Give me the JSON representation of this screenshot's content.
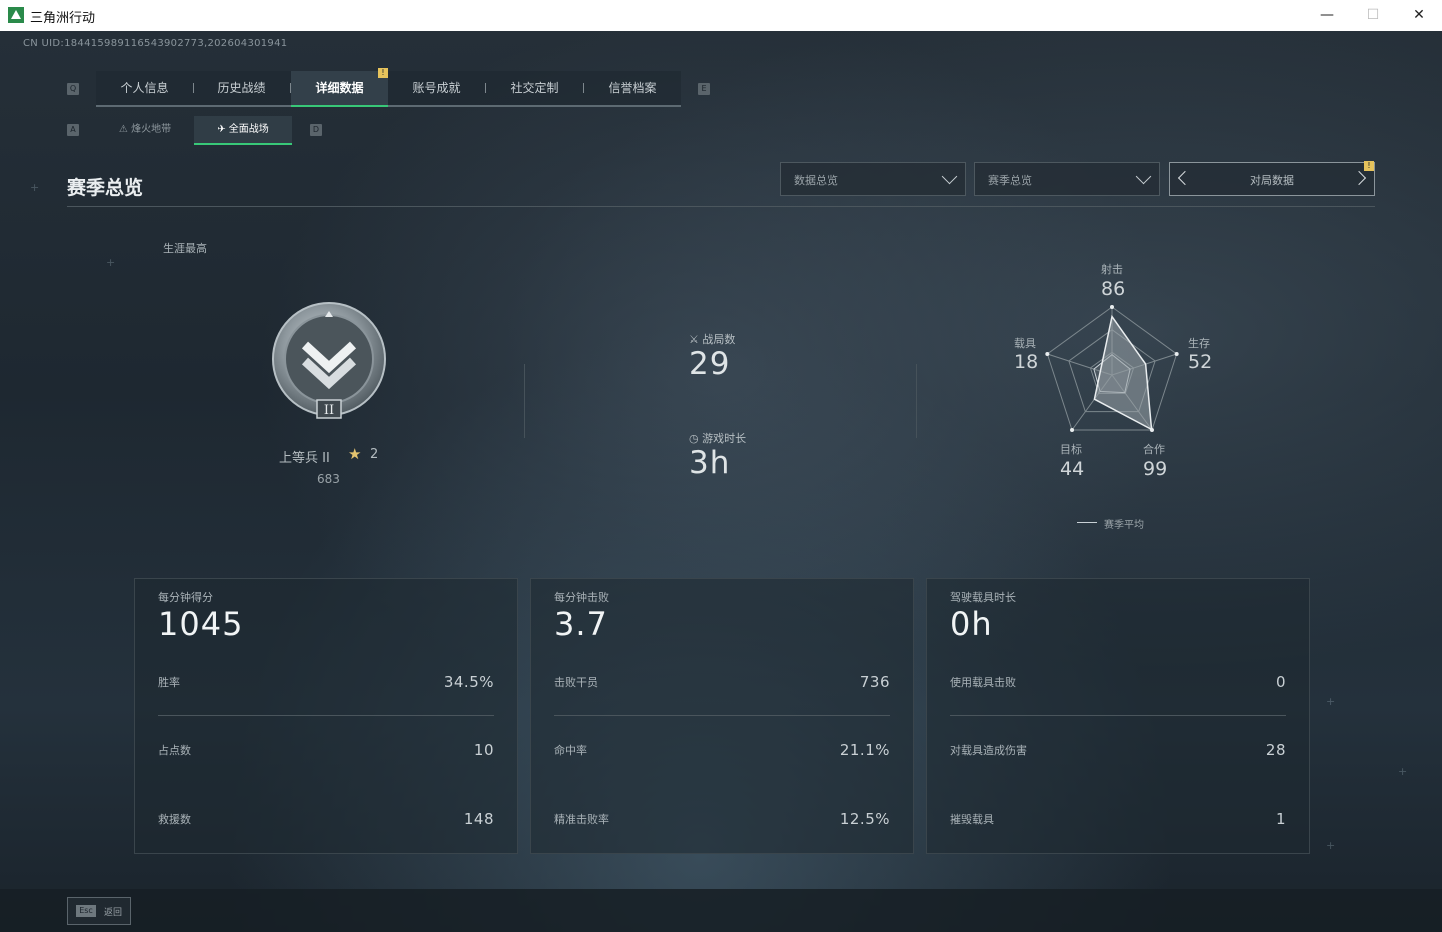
{
  "window": {
    "title": "三角洲行动",
    "minimize": "—",
    "maximize": "☐",
    "close": "✕"
  },
  "uid": "CN UID:184415989116543902773,202604301941",
  "tabs": {
    "left_key": "Q",
    "right_key": "E",
    "items": [
      {
        "label": "个人信息"
      },
      {
        "label": "历史战绩"
      },
      {
        "label": "详细数据",
        "active": true
      },
      {
        "label": "账号成就"
      },
      {
        "label": "社交定制"
      },
      {
        "label": "信誉档案"
      }
    ],
    "badge": "!"
  },
  "subtabs": {
    "left_key": "A",
    "right_key": "D",
    "items": [
      {
        "label": "烽火地带",
        "icon": "flame-zone-icon"
      },
      {
        "label": "全面战场",
        "icon": "battlefield-icon",
        "active": true
      }
    ]
  },
  "section_title": "赛季总览",
  "dropdowns": [
    {
      "label": "数据总览"
    },
    {
      "label": "赛季总览"
    }
  ],
  "pager": {
    "label": "对局数据",
    "badge": "!"
  },
  "career": {
    "label": "生涯最高",
    "rank_name": "上等兵 II",
    "rank_numeral": "II",
    "stars": "2",
    "score": "683"
  },
  "overview": {
    "matches_label": "战局数",
    "matches_value": "29",
    "playtime_label": "游戏时长",
    "playtime_value": "3h"
  },
  "radar": {
    "axes": [
      {
        "label": "射击",
        "value": "86"
      },
      {
        "label": "生存",
        "value": "52"
      },
      {
        "label": "合作",
        "value": "99"
      },
      {
        "label": "目标",
        "value": "44"
      },
      {
        "label": "载具",
        "value": "18"
      }
    ],
    "values": [
      86,
      52,
      99,
      44,
      18
    ],
    "average": [
      30,
      28,
      32,
      30,
      28
    ],
    "max": 100,
    "legend": "赛季平均",
    "colors": {
      "grid": "#7c878d",
      "fill": "#9aa4a9",
      "stroke": "#e9edef"
    }
  },
  "cards": [
    {
      "title": "每分钟得分",
      "big": "1045",
      "rows": [
        {
          "label": "胜率",
          "value": "34.5%"
        },
        {
          "label": "占点数",
          "value": "10"
        },
        {
          "label": "救援数",
          "value": "148"
        }
      ]
    },
    {
      "title": "每分钟击败",
      "big": "3.7",
      "rows": [
        {
          "label": "击败干员",
          "value": "736"
        },
        {
          "label": "命中率",
          "value": "21.1%"
        },
        {
          "label": "精准击败率",
          "value": "12.5%"
        }
      ]
    },
    {
      "title": "驾驶载具时长",
      "big": "0h",
      "rows": [
        {
          "label": "使用载具击败",
          "value": "0"
        },
        {
          "label": "对载具造成伤害",
          "value": "28"
        },
        {
          "label": "摧毁载具",
          "value": "1"
        }
      ]
    }
  ],
  "footer": {
    "esc_key": "Esc",
    "esc_label": "返回"
  },
  "colors": {
    "accent": "#38c878",
    "badge": "#e6c35c"
  }
}
